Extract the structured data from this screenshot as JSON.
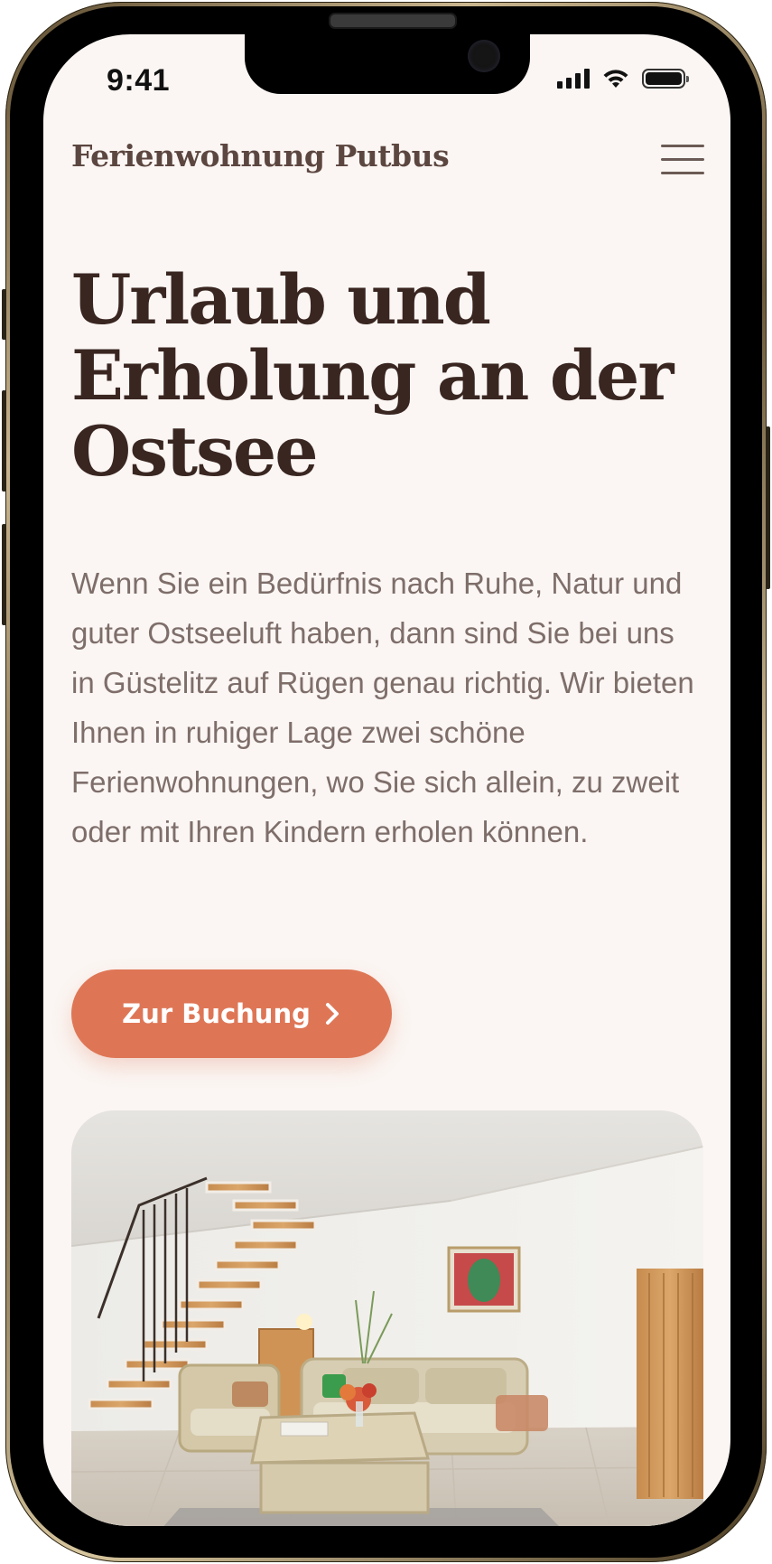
{
  "status": {
    "time": "9:41"
  },
  "header": {
    "brand": "Ferienwohnung Putbus"
  },
  "hero": {
    "title": "Urlaub und Erholung an der Ostsee",
    "text": "Wenn Sie ein Bedürfnis nach Ruhe, Natur und guter Ostseeluft haben, dann sind Sie bei uns in Güstelitz auf Rügen genau richtig. Wir bieten Ihnen in ruhiger Lage zwei schöne Ferienwohnungen, wo Sie sich allein, zu zweit oder mit Ihren Kindern erholen können.",
    "cta_label": "Zur Buchung"
  },
  "colors": {
    "background": "#fbf6f3",
    "accent": "#de7656",
    "title": "#3a2621",
    "body_text": "#7e6e6a"
  },
  "icons": {
    "menu": "hamburger-menu-icon",
    "cta": "chevron-right-icon"
  }
}
